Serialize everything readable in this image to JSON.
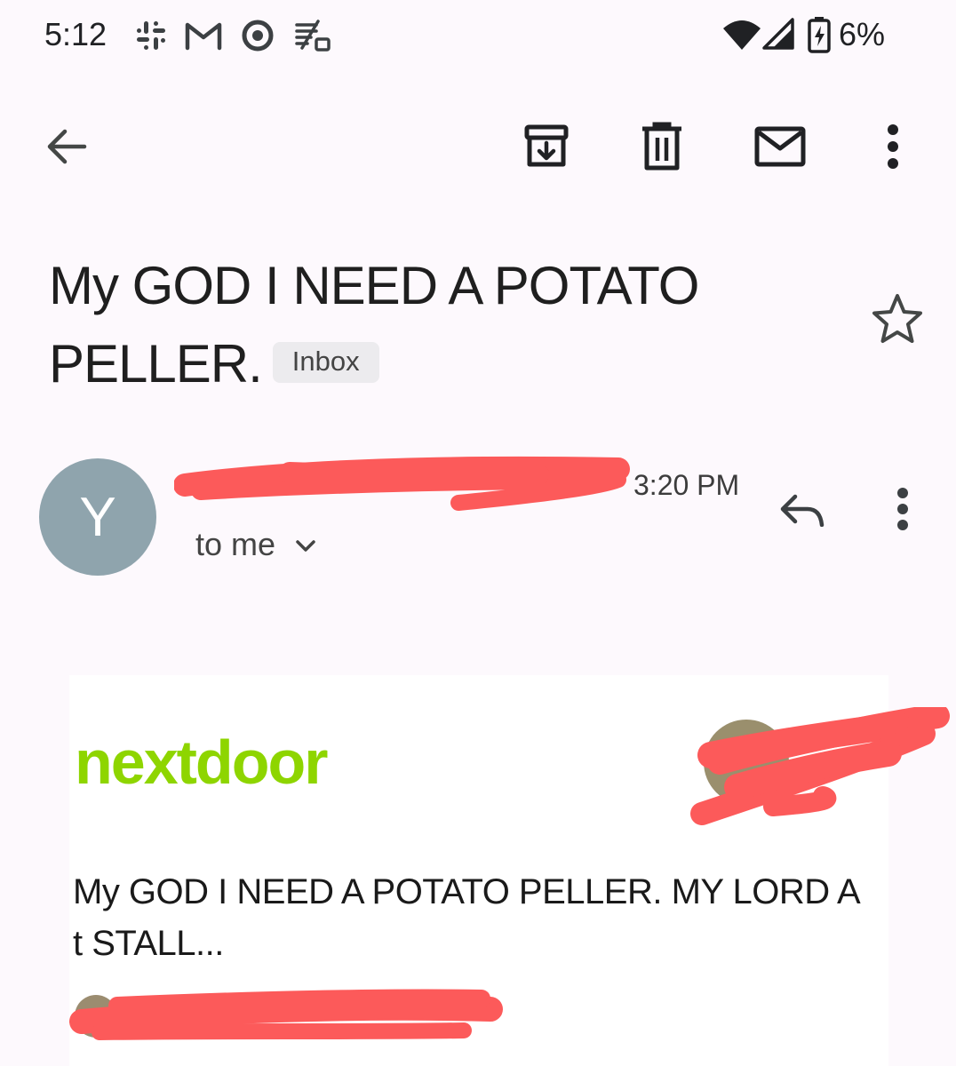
{
  "status_bar": {
    "time": "5:12",
    "battery_percent": "6%",
    "icons": [
      "slack-icon",
      "gmail-icon",
      "circle-app-icon",
      "document-icon",
      "wifi-icon",
      "signal-icon",
      "battery-charging-icon"
    ]
  },
  "toolbar": {
    "icons": [
      "back-arrow-icon",
      "archive-icon",
      "delete-icon",
      "mark-unread-icon",
      "more-vert-icon"
    ]
  },
  "email": {
    "subject": "My GOD I NEED A POTATO PELLER.",
    "label_chip": "Inbox",
    "sender_initial": "Y",
    "time": "3:20 PM",
    "recipient": "to me"
  },
  "card": {
    "logo_text": "nextdoor",
    "body": "My GOD I NEED A POTATO PELLER. MY LORD A t STALL..."
  },
  "colors": {
    "background": "#fdf9fd",
    "avatar": "#8fa4ad",
    "nextdoor_green": "#8ed500",
    "redaction": "#fc5a5a"
  }
}
